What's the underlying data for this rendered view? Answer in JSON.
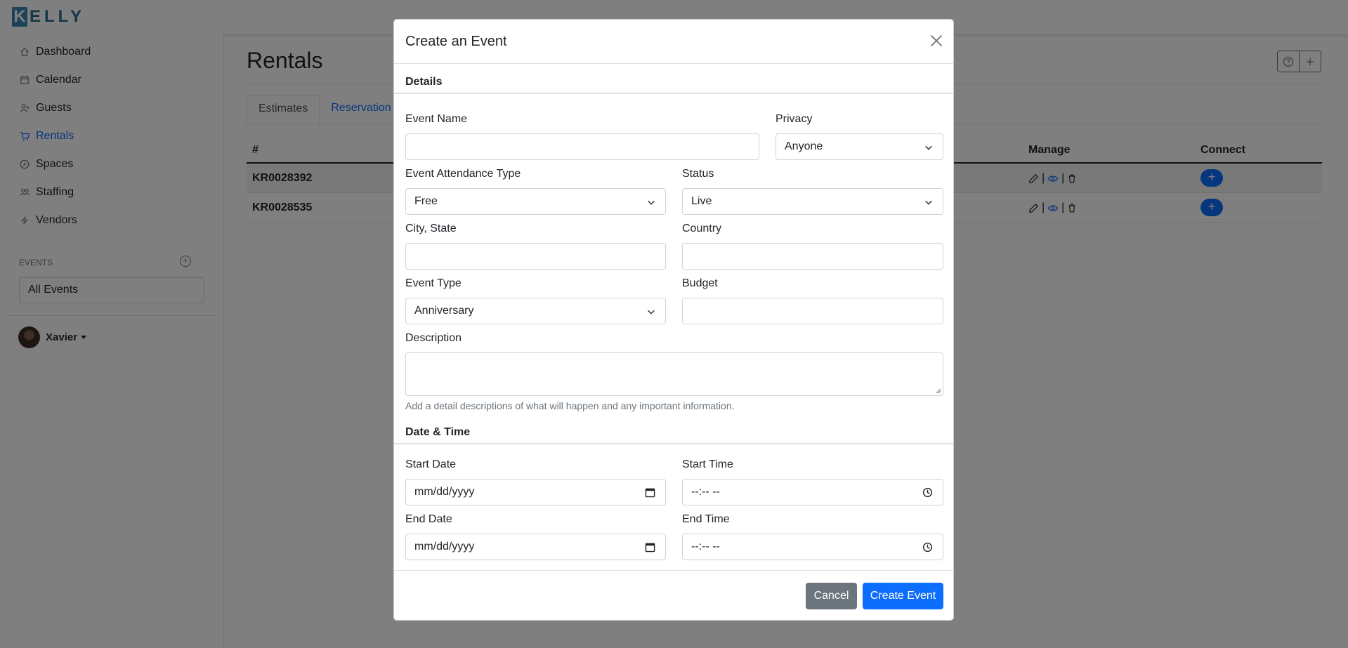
{
  "app": {
    "logo_initial": "K",
    "logo_rest": "ELLY"
  },
  "sidebar": {
    "items": [
      {
        "label": "Dashboard",
        "icon": "home-icon"
      },
      {
        "label": "Calendar",
        "icon": "calendar-icon"
      },
      {
        "label": "Guests",
        "icon": "person-plus-icon"
      },
      {
        "label": "Rentals",
        "icon": "cart-icon",
        "active": true
      },
      {
        "label": "Spaces",
        "icon": "compass-icon"
      },
      {
        "label": "Staffing",
        "icon": "people-icon"
      },
      {
        "label": "Vendors",
        "icon": "lightning-icon"
      }
    ],
    "events_label": "EVENTS",
    "all_events": "All Events",
    "user_name": "Xavier"
  },
  "page": {
    "title": "Rentals",
    "tabs": [
      "Estimates",
      "Reservation"
    ],
    "table": {
      "headers": {
        "num": "#",
        "manage": "Manage",
        "connect": "Connect"
      },
      "rows": [
        {
          "num": "KR0028392"
        },
        {
          "num": "KR0028535"
        }
      ],
      "connect_symbol": "+"
    }
  },
  "modal": {
    "title": "Create an Event",
    "details_heading": "Details",
    "event_name": {
      "label": "Event Name",
      "value": ""
    },
    "privacy": {
      "label": "Privacy",
      "value": "Anyone"
    },
    "attendance_type": {
      "label": "Event Attendance Type",
      "value": "Free"
    },
    "status": {
      "label": "Status",
      "value": "Live"
    },
    "city_state": {
      "label": "City, State",
      "value": ""
    },
    "country": {
      "label": "Country",
      "value": ""
    },
    "event_type": {
      "label": "Event Type",
      "value": "Anniversary"
    },
    "budget": {
      "label": "Budget",
      "value": ""
    },
    "description": {
      "label": "Description",
      "help": "Add a detail descriptions of what will happen and any important information."
    },
    "datetime_heading": "Date & Time",
    "start_date": {
      "label": "Start Date",
      "placeholder": "mm/dd/yyyy"
    },
    "start_time": {
      "label": "Start Time",
      "placeholder": "--:-- --"
    },
    "end_date": {
      "label": "End Date",
      "placeholder": "mm/dd/yyyy"
    },
    "end_time": {
      "label": "End Time",
      "placeholder": "--:-- --"
    },
    "cancel_label": "Cancel",
    "create_label": "Create Event"
  },
  "colors": {
    "primary": "#0d6efd",
    "secondary": "#6c757d",
    "brand": "#2b6a93"
  }
}
